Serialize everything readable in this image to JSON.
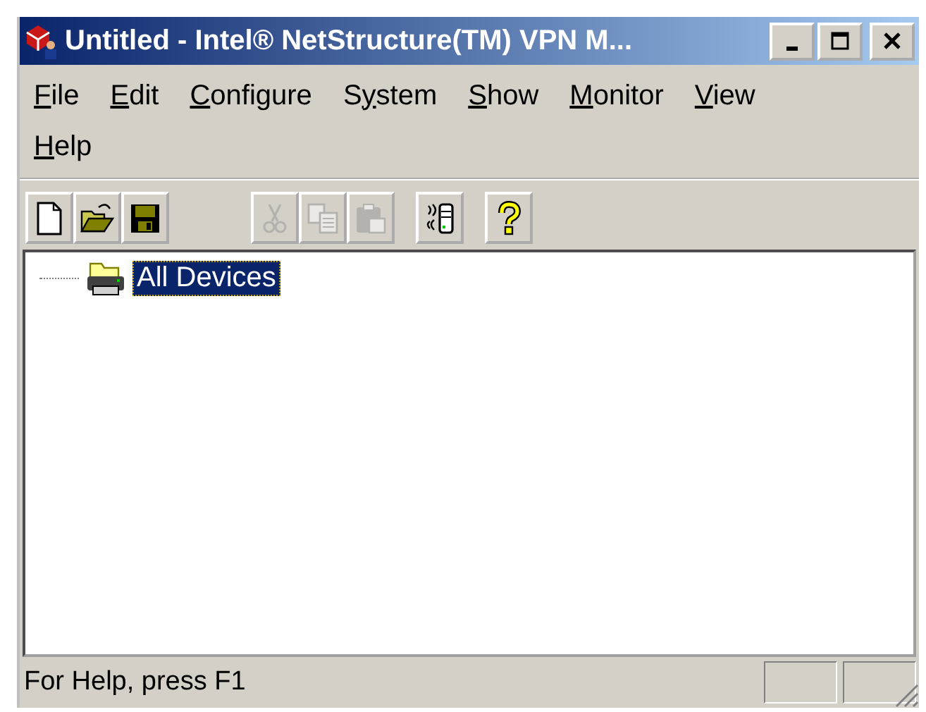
{
  "window": {
    "title": "Untitled - Intel® NetStructure(TM) VPN M..."
  },
  "menu": {
    "rows": [
      [
        {
          "key": "F",
          "post": "ile"
        },
        {
          "key": "E",
          "post": "dit"
        },
        {
          "key": "C",
          "post": "onfigure"
        },
        {
          "pre": "S",
          "key": "y",
          "post": "stem"
        },
        {
          "key": "S",
          "post": "how"
        },
        {
          "key": "M",
          "post": "onitor"
        },
        {
          "key": "V",
          "post": "iew"
        }
      ],
      [
        {
          "key": "H",
          "post": "elp"
        }
      ]
    ]
  },
  "toolbar": {
    "groups": [
      [
        {
          "kind": "new",
          "disabled": false
        },
        {
          "kind": "open",
          "disabled": false
        },
        {
          "kind": "save",
          "disabled": false
        }
      ],
      [
        {
          "kind": "cut",
          "disabled": true
        },
        {
          "kind": "copy",
          "disabled": true
        },
        {
          "kind": "paste",
          "disabled": true
        }
      ],
      [
        {
          "kind": "connect",
          "disabled": false
        }
      ],
      [
        {
          "kind": "help",
          "disabled": false
        }
      ]
    ]
  },
  "tree": {
    "items": [
      {
        "label": "All Devices",
        "selected": true
      }
    ]
  },
  "status_bar": {
    "text": "For Help, press F1"
  }
}
